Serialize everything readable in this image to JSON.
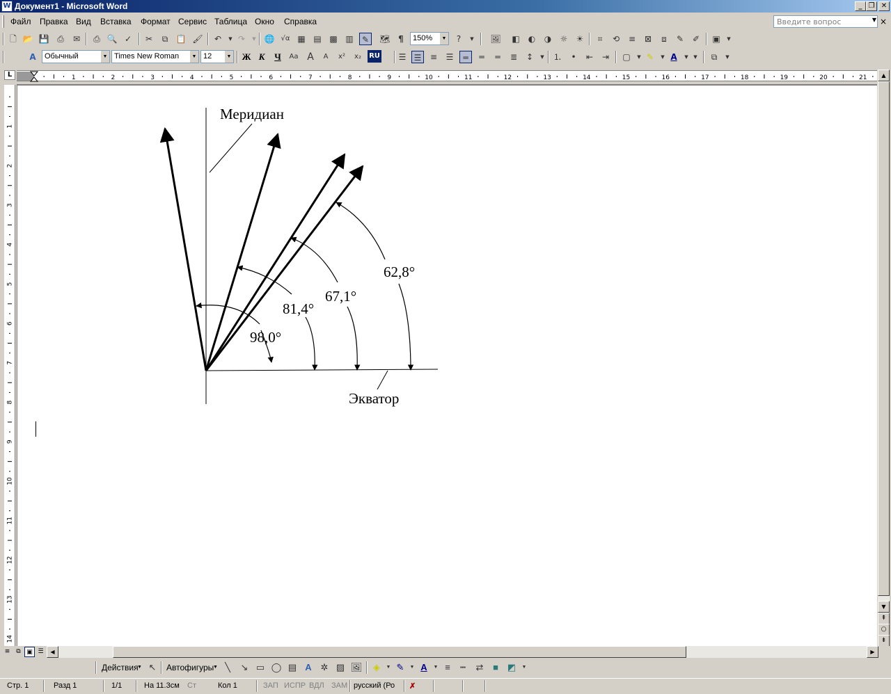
{
  "window": {
    "title": "Документ1 - Microsoft Word",
    "icon_label": "W"
  },
  "menu": {
    "items": [
      "Файл",
      "Правка",
      "Вид",
      "Вставка",
      "Формат",
      "Сервис",
      "Таблица",
      "Окно",
      "Справка"
    ],
    "help_placeholder": "Введите вопрос"
  },
  "standard_toolbar": {
    "zoom": "150%"
  },
  "formatting_toolbar": {
    "style": "Обычный",
    "font": "Times New Roman",
    "size": "12",
    "bold": "Ж",
    "italic": "К",
    "underline": "Ч",
    "language": "RU"
  },
  "ruler": {
    "horizontal_ticks": [
      "1",
      "2",
      "3",
      "4",
      "5",
      "6",
      "7",
      "8",
      "9",
      "10",
      "11",
      "12",
      "13",
      "14",
      "15",
      "16",
      "17",
      "18",
      "19",
      "20",
      "21"
    ],
    "vertical_ticks": [
      "1",
      "2",
      "3",
      "4",
      "5",
      "6",
      "7",
      "8",
      "9",
      "10",
      "11",
      "12",
      "13",
      "14"
    ],
    "corner": "L"
  },
  "figure": {
    "meridian_label": "Меридиан",
    "equator_label": "Экватор",
    "angles": [
      "98,0°",
      "81,4°",
      "67,1°",
      "62,8°"
    ]
  },
  "drawing_toolbar": {
    "actions": "Действия",
    "autoshapes": "Автофигуры"
  },
  "status": {
    "page": "Стр. 1",
    "section": "Разд 1",
    "pages": "1/1",
    "position": "На 11.3см",
    "line": "Ст",
    "column": "Кол 1",
    "rec": "ЗАП",
    "trk": "ИСПР",
    "ext": "ВДЛ",
    "ovr": "ЗАМ",
    "language": "русский (Ро"
  },
  "colors": {
    "title_start": "#0A246A",
    "title_end": "#A6CAF0",
    "chrome": "#D4D0C8"
  }
}
